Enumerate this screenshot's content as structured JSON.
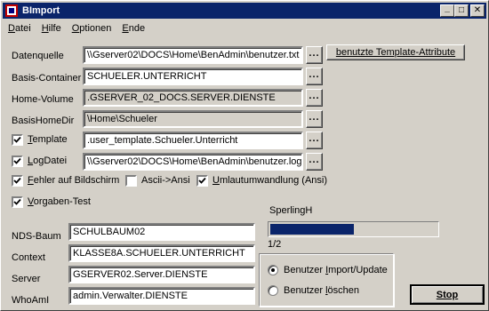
{
  "window": {
    "title": "BImport"
  },
  "titlebar_buttons": {
    "minimize": "_",
    "maximize": "□",
    "close": "✕"
  },
  "menu": {
    "datei": {
      "ul": "D",
      "rest": "atei"
    },
    "hilfe": {
      "ul": "H",
      "rest": "ilfe"
    },
    "optionen": {
      "ul": "O",
      "rest": "ptionen"
    },
    "ende": {
      "ul": "E",
      "rest": "nde"
    }
  },
  "config": {
    "datenquelle": {
      "label": "Datenquelle",
      "value": "\\\\Gserver02\\DOCS\\Home\\BenAdmin\\benutzer.txt"
    },
    "basis_container": {
      "label": "Basis-Container",
      "value": "SCHUELER.UNTERRICHT"
    },
    "home_volume": {
      "label": "Home-Volume",
      "value": ".GSERVER_02_DOCS.SERVER.DIENSTE"
    },
    "basis_home_dir": {
      "label": "BasisHomeDir",
      "value": "\\Home\\Schueler"
    },
    "template": {
      "label": "Template",
      "value": ".user_template.Schueler.Unterricht"
    },
    "log_datei": {
      "label": "LogDatei",
      "value": "\\\\Gserver02\\DOCS\\Home\\BenAdmin\\benutzer.log"
    }
  },
  "browse_button": {
    "label": "..."
  },
  "template_attr_button": {
    "label": "benutzte Template-Attribute"
  },
  "options": {
    "template_check": true,
    "logdatei_check": true,
    "fehler_auf_bildschirm": {
      "label": "Fehler auf Bildschirm",
      "checked": true
    },
    "ascii_ansi": {
      "label": "Ascii->Ansi",
      "checked": false
    },
    "umlautumwandlung": {
      "label": "Umlautumwandlung (Ansi)",
      "checked": true
    },
    "vorgaben_test": {
      "label": "Vorgaben-Test",
      "checked": true
    }
  },
  "tree": {
    "nds_baum": {
      "label": "NDS-Baum",
      "value": "SCHULBAUM02"
    },
    "context": {
      "label": "Context",
      "value": "KLASSE8A.SCHUELER.UNTERRICHT"
    },
    "server": {
      "label": "Server",
      "value": "GSERVER02.Server.DIENSTE"
    },
    "whoami": {
      "label": "WhoAmI",
      "value": "admin.Verwalter.DIENSTE"
    }
  },
  "progress": {
    "user": "SperlingH",
    "count_text": "1/2",
    "fraction": 0.5
  },
  "mode": {
    "import_update": {
      "label": "Benutzer Import/Update",
      "selected": true
    },
    "loeschen": {
      "label": "Benutzer löschen",
      "selected": false
    }
  },
  "stop_button": {
    "label": "Stop"
  },
  "colors": {
    "titlebar": "#0a246a",
    "face": "#d4d0c8",
    "progress_fill": "#0a246a"
  }
}
